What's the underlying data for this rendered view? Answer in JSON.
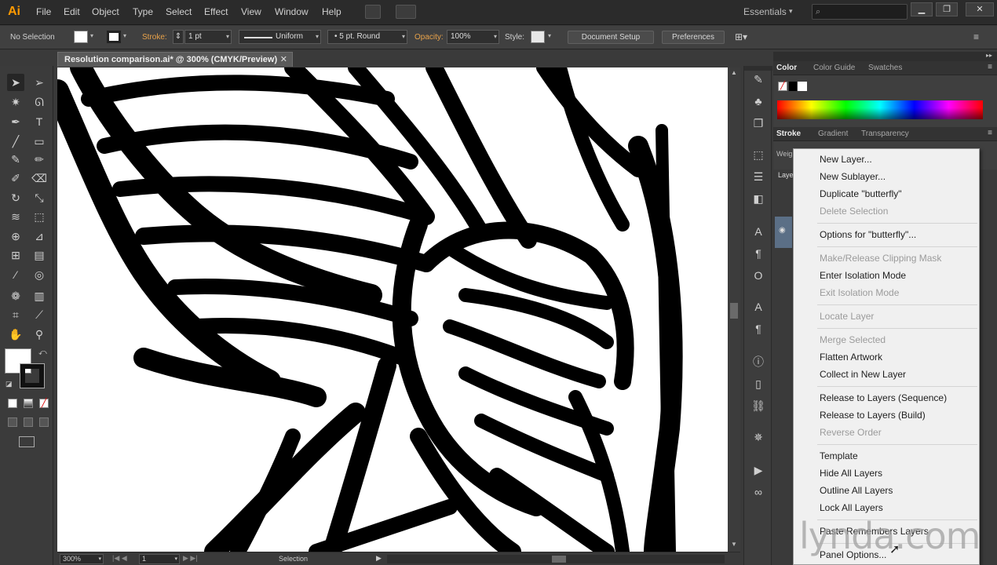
{
  "app": {
    "logo": "Ai"
  },
  "menu": {
    "items": [
      "File",
      "Edit",
      "Object",
      "Type",
      "Select",
      "Effect",
      "View",
      "Window",
      "Help"
    ],
    "workspace": "Essentials"
  },
  "control_bar": {
    "selection": "No Selection",
    "stroke_label": "Stroke:",
    "stroke_weight": "1 pt",
    "profile": "Uniform",
    "brush": "5 pt. Round",
    "opacity_label": "Opacity:",
    "opacity": "100%",
    "style_label": "Style:",
    "document_setup": "Document Setup",
    "preferences": "Preferences"
  },
  "document": {
    "tab_title": "Resolution comparison.ai* @ 300% (CMYK/Preview)",
    "zoom": "300%",
    "artboard": "1",
    "status": "Selection"
  },
  "panels": {
    "color_tabs": [
      "Color",
      "Color Guide",
      "Swatches"
    ],
    "stroke_tabs": [
      "Stroke",
      "Gradient",
      "Transparency"
    ],
    "weight_label": "Weig",
    "layers_label": "Laye"
  },
  "context_menu": {
    "items": [
      {
        "label": "New Layer...",
        "enabled": true
      },
      {
        "label": "New Sublayer...",
        "enabled": true
      },
      {
        "label": "Duplicate \"butterfly\"",
        "enabled": true
      },
      {
        "label": "Delete Selection",
        "enabled": false
      },
      {
        "label": "Options for \"butterfly\"...",
        "enabled": true
      },
      {
        "label": "Make/Release Clipping Mask",
        "enabled": false
      },
      {
        "label": "Enter Isolation Mode",
        "enabled": true
      },
      {
        "label": "Exit Isolation Mode",
        "enabled": false
      },
      {
        "label": "Locate Layer",
        "enabled": false
      },
      {
        "label": "Merge Selected",
        "enabled": false
      },
      {
        "label": "Flatten Artwork",
        "enabled": true
      },
      {
        "label": "Collect in New Layer",
        "enabled": true
      },
      {
        "label": "Release to Layers (Sequence)",
        "enabled": true
      },
      {
        "label": "Release to Layers (Build)",
        "enabled": true
      },
      {
        "label": "Reverse Order",
        "enabled": false
      },
      {
        "label": "Template",
        "enabled": true
      },
      {
        "label": "Hide All Layers",
        "enabled": true
      },
      {
        "label": "Outline All Layers",
        "enabled": true
      },
      {
        "label": "Lock All Layers",
        "enabled": true
      },
      {
        "label": "Paste Remembers Layers",
        "enabled": true
      },
      {
        "label": "Panel Options...",
        "enabled": true
      }
    ]
  },
  "watermark": "lynda.com",
  "colors": {
    "accent": "#ff9a00",
    "panel_bg": "#3f3f3f",
    "menu_bg": "#f0f0f0"
  }
}
